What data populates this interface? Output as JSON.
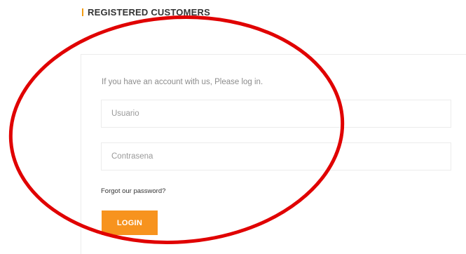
{
  "section": {
    "title": "REGISTERED CUSTOMERS"
  },
  "login_form": {
    "intro": "If you have an account with us, Please log in.",
    "username_placeholder": "Usuario",
    "password_placeholder": "Contrasena",
    "forgot_link": "Forgot our password?",
    "login_button": "LOGIN"
  },
  "colors": {
    "accent": "#f7931e",
    "annotation_circle": "#e00000",
    "border": "#ececec"
  },
  "annotation": {
    "shape": "ellipse",
    "color": "#e00000"
  }
}
